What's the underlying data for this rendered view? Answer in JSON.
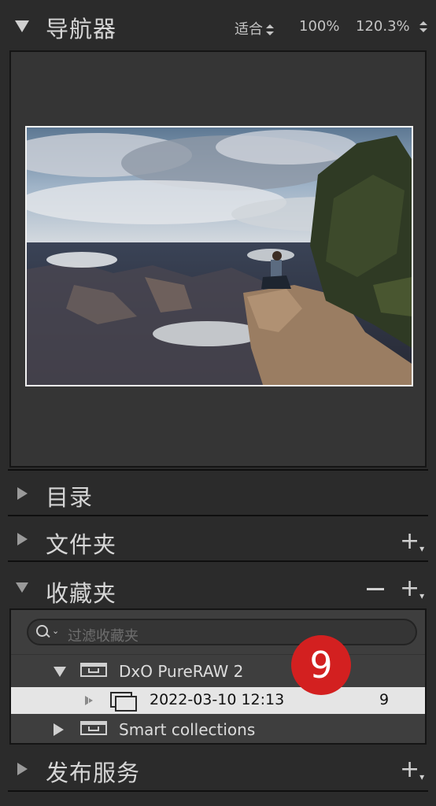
{
  "navigator": {
    "title": "导航器",
    "zoom_fit": "适合",
    "zoom_100": "100%",
    "zoom_custom": "120.3%"
  },
  "panels": {
    "catalog": "目录",
    "folders": "文件夹",
    "collections": "收藏夹",
    "publish": "发布服务"
  },
  "collections": {
    "filter_placeholder": "过滤收藏夹",
    "items": [
      {
        "label": "DxO PureRAW 2"
      },
      {
        "label": "2022-03-10 12:13",
        "count": "9"
      },
      {
        "label": "Smart collections"
      }
    ]
  },
  "badge": {
    "number": "9",
    "color": "#d32020"
  },
  "colors": {
    "panel_bg": "#2b2b2b",
    "selected_row": "#e5e5e5"
  }
}
